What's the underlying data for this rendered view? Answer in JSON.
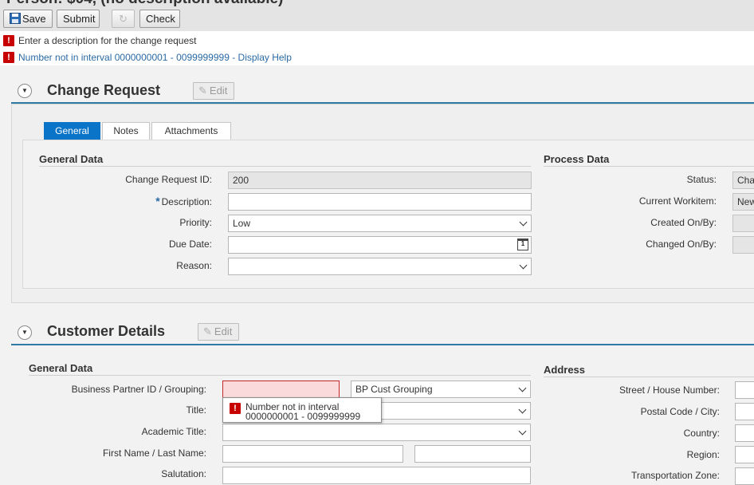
{
  "app": {
    "title_partial": "Person: $04, (no description available)"
  },
  "toolbar": {
    "save_label": "Save",
    "submit_label": "Submit",
    "check_label": "Check"
  },
  "messages": [
    {
      "text": "Enter a description for the change request",
      "type": "error"
    },
    {
      "text": "Number not in interval 0000000001 - 0099999999 - Display Help",
      "type": "error-link"
    }
  ],
  "change_request": {
    "title": "Change Request",
    "edit_label": "Edit",
    "tabs": [
      {
        "label": "General",
        "active": true
      },
      {
        "label": "Notes",
        "active": false
      },
      {
        "label": "Attachments",
        "active": false
      }
    ],
    "general_data": {
      "title": "General Data",
      "id_label": "Change Request ID:",
      "id_value": "200",
      "required_marker": "*",
      "description_label": "Description:",
      "description_value": "",
      "priority_label": "Priority:",
      "priority_value": "Low",
      "due_date_label": "Due Date:",
      "due_date_value": "",
      "calendar_day": "1",
      "reason_label": "Reason:",
      "reason_value": ""
    },
    "process_data": {
      "title": "Process Data",
      "status_label": "Status:",
      "status_value": "Cha",
      "workitem_label": "Current Workitem:",
      "workitem_value": "New",
      "created_label": "Created On/By:",
      "changed_label": "Changed On/By:"
    }
  },
  "customer_details": {
    "title": "Customer Details",
    "edit_label": "Edit",
    "general_data": {
      "title": "General Data",
      "bp_label": "Business Partner ID / Grouping:",
      "bp_id_value": "",
      "bp_grouping_value": "BP Cust Grouping",
      "title_label": "Title:",
      "academic_title_label": "Academic Title:",
      "name_label": "First Name / Last Name:",
      "salutation_label": "Salutation:"
    },
    "tooltip": {
      "line1": "Number not in interval",
      "line2": "0000000001 - 0099999999"
    },
    "address": {
      "title": "Address",
      "street_label": "Street / House Number:",
      "postal_label": "Postal Code / City:",
      "country_label": "Country:",
      "region_label": "Region:",
      "transport_label": "Transportation Zone:"
    }
  },
  "colors": {
    "accent": "#0a74c8",
    "section_line": "#2f7ba6",
    "error": "#c70000"
  }
}
